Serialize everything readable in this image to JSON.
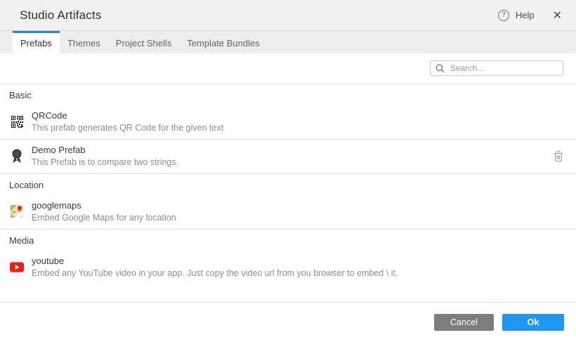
{
  "dialog": {
    "title": "Studio Artifacts",
    "help_label": "Help",
    "close_glyph": "✕",
    "help_glyph": "?"
  },
  "tabs": [
    {
      "label": "Prefabs",
      "active": true
    },
    {
      "label": "Themes",
      "active": false
    },
    {
      "label": "Project Shells",
      "active": false
    },
    {
      "label": "Template Bundles",
      "active": false
    }
  ],
  "search": {
    "placeholder": "Search...",
    "icon": "magnifier-icon"
  },
  "sections": [
    {
      "name": "Basic",
      "items": [
        {
          "title": "QRCode",
          "description": "This prefab generates QR Code for the given text",
          "icon": "qrcode-icon",
          "deletable": false
        },
        {
          "title": "Demo Prefab",
          "description": "This Prefab is to compare two strings.",
          "icon": "award-ribbon-icon",
          "deletable": true
        }
      ]
    },
    {
      "name": "Location",
      "items": [
        {
          "title": "googlemaps",
          "description": "Embed Google Maps for any location",
          "icon": "google-maps-icon",
          "deletable": false
        }
      ]
    },
    {
      "name": "Media",
      "items": [
        {
          "title": "youtube",
          "description": "Embed any YouTube video in your app. Just copy the video url from you browser to embed \\ it.",
          "icon": "youtube-icon",
          "deletable": false
        }
      ]
    }
  ],
  "footer": {
    "cancel_label": "Cancel",
    "ok_label": "Ok"
  },
  "colors": {
    "accent_blue": "#1b86f3",
    "ok_blue": "#1e96f3",
    "cancel_gray": "#7d7d7d",
    "header_bg": "#f1f1f1",
    "tabbar_bg": "#ededed",
    "divider": "#e0e0e0",
    "youtube_red": "#e62117"
  }
}
